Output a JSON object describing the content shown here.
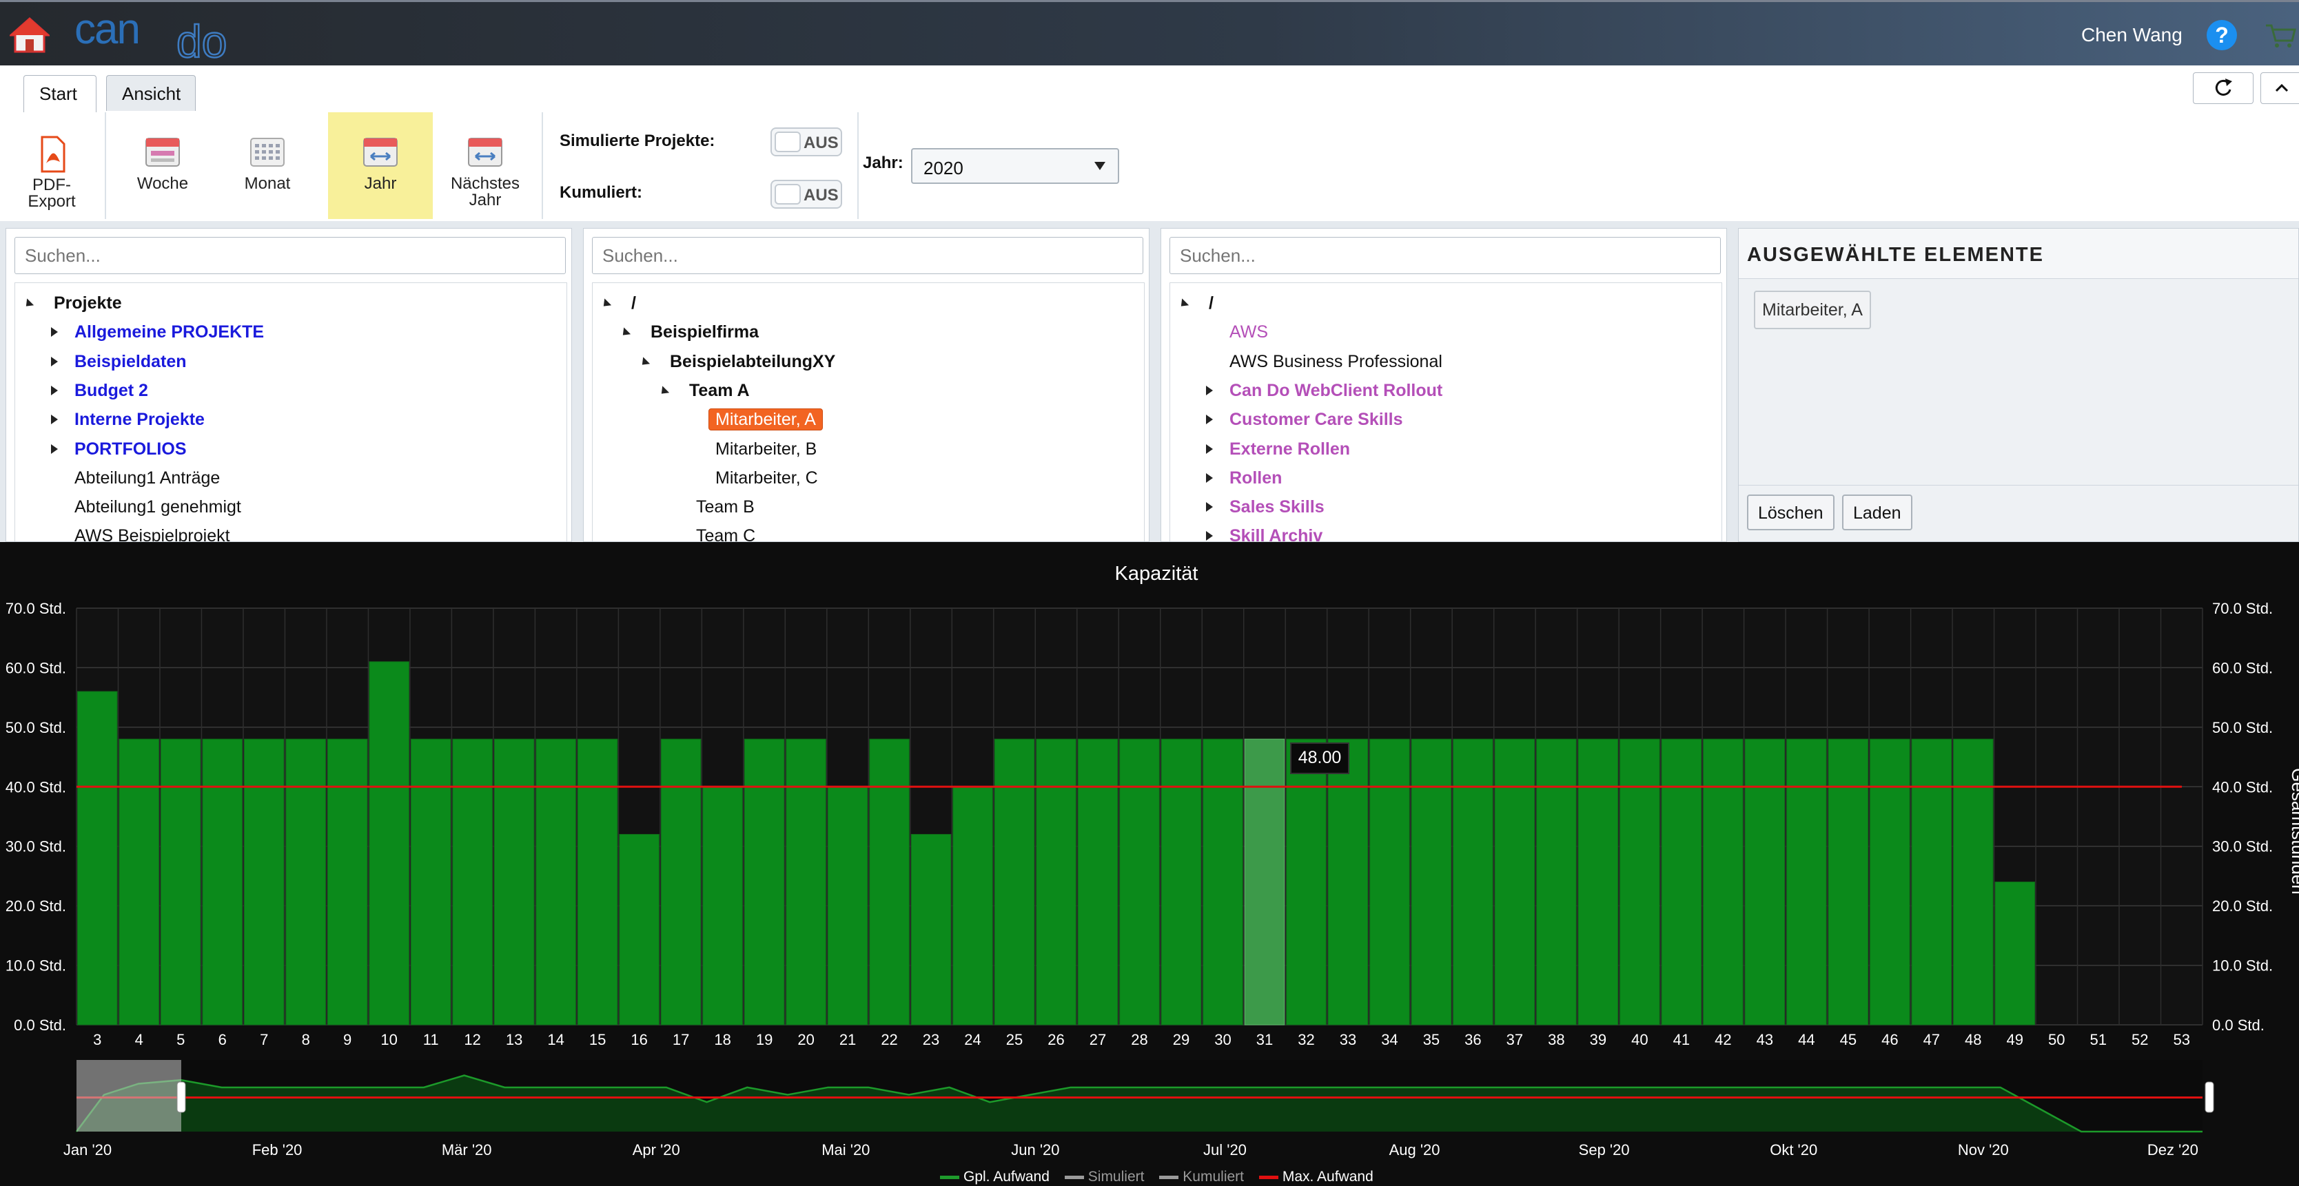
{
  "header": {
    "user_name": "Chen Wang",
    "help_symbol": "?",
    "logo_text": "cando"
  },
  "tabs": [
    {
      "label": "Start"
    },
    {
      "label": "Ansicht"
    }
  ],
  "ribbon": {
    "pdf_export": "PDF-Export",
    "woche": "Woche",
    "monat": "Monat",
    "jahr": "Jahr",
    "naechstes_jahr": "Nächstes Jahr",
    "simulierte_projekte_label": "Simulierte Projekte:",
    "kumuliert_label": "Kumuliert:",
    "toggle_off": "AUS",
    "jahr_label": "Jahr:",
    "jahr_value": "2020"
  },
  "panels": {
    "search_placeholder": "Suchen...",
    "projects": {
      "root": "Projekte",
      "items": [
        "Allgemeine PROJEKTE",
        "Beispieldaten",
        "Budget 2",
        "Interne Projekte",
        "PORTFOLIOS",
        "Abteilung1 Anträge",
        "Abteilung1 genehmigt",
        "AWS Beispielprojekt"
      ]
    },
    "org": {
      "root": "/",
      "company": "Beispielfirma",
      "department": "BeispielabteilungXY",
      "team_a": "Team A",
      "members": [
        "Mitarbeiter, A",
        "Mitarbeiter, B",
        "Mitarbeiter, C"
      ],
      "team_b": "Team B",
      "team_c": "Team C"
    },
    "skills": {
      "root": "/",
      "items": [
        "AWS",
        "AWS Business Professional",
        "Can Do WebClient Rollout",
        "Customer Care Skills",
        "Externe Rollen",
        "Rollen",
        "Sales Skills",
        "Skill Archiv"
      ]
    },
    "selected": {
      "title": "AUSGEWÄHLTE ELEMENTE",
      "chip": "Mitarbeiter, A",
      "delete": "Löschen",
      "load": "Laden"
    }
  },
  "chart_data": {
    "type": "bar",
    "title": "Kapazität",
    "ylabel_right": "Gesamtstunden",
    "y_ticks": [
      "0.0 Std.",
      "10.0 Std.",
      "20.0 Std.",
      "30.0 Std.",
      "40.0 Std.",
      "50.0 Std.",
      "60.0 Std.",
      "70.0 Std."
    ],
    "ylim": [
      0,
      70
    ],
    "categories": [
      "3",
      "4",
      "5",
      "6",
      "7",
      "8",
      "9",
      "10",
      "11",
      "12",
      "13",
      "14",
      "15",
      "16",
      "17",
      "18",
      "19",
      "20",
      "21",
      "22",
      "23",
      "24",
      "25",
      "26",
      "27",
      "28",
      "29",
      "30",
      "31",
      "32",
      "33",
      "34",
      "35",
      "36",
      "37",
      "38",
      "39",
      "40",
      "41",
      "42",
      "43",
      "44",
      "45",
      "46",
      "47",
      "48",
      "49",
      "50",
      "51",
      "52",
      "53"
    ],
    "series": [
      {
        "name": "Gpl. Aufwand",
        "color": "#0b8a1b",
        "values": [
          56,
          48,
          48,
          48,
          48,
          48,
          48,
          61,
          48,
          48,
          48,
          48,
          48,
          32,
          48,
          40,
          48,
          48,
          40,
          48,
          32,
          40,
          48,
          48,
          48,
          48,
          48,
          48,
          48,
          48,
          48,
          48,
          48,
          48,
          48,
          48,
          48,
          48,
          48,
          48,
          48,
          48,
          48,
          48,
          48,
          48,
          24,
          0,
          0,
          0,
          0
        ]
      },
      {
        "name": "Max. Aufwand",
        "color": "#e01010",
        "values": [
          40
        ]
      }
    ],
    "highlighted_category": "31",
    "tooltip_value": "48.00",
    "navigator_months": [
      "Jan '20",
      "Feb '20",
      "Mär '20",
      "Apr '20",
      "Mai '20",
      "Jun '20",
      "Jul '20",
      "Aug '20",
      "Sep '20",
      "Okt '20",
      "Nov '20",
      "Dez '20"
    ],
    "legend": [
      {
        "name": "Gpl. Aufwand",
        "color": "#1e9a2c"
      },
      {
        "name": "Simuliert",
        "color": "#9a9a9a"
      },
      {
        "name": "Kumuliert",
        "color": "#9a9a9a"
      },
      {
        "name": "Max. Aufwand",
        "color": "#e01010"
      }
    ]
  }
}
